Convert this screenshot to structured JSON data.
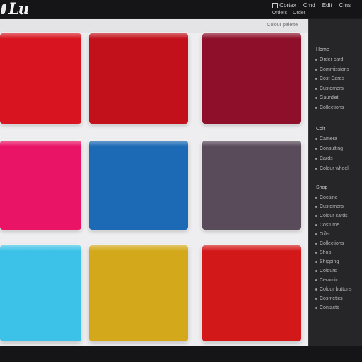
{
  "header": {
    "logo_text": "Lu",
    "top_nav": [
      "Cortex",
      "Cmd",
      "Edit",
      "Cms"
    ],
    "sub_nav": [
      "Orders",
      "Order"
    ]
  },
  "canvas": {
    "crumb": "Colour palette"
  },
  "swatches": [
    {
      "name": "red",
      "color": "#d7141f"
    },
    {
      "name": "crimson",
      "color": "#c3111c"
    },
    {
      "name": "burgundy",
      "color": "#8e0f2a"
    },
    {
      "name": "pink",
      "color": "#ea1466"
    },
    {
      "name": "blue",
      "color": "#1c6ab5"
    },
    {
      "name": "slate",
      "color": "#5a4b5b"
    },
    {
      "name": "cyan",
      "color": "#3cc2e8"
    },
    {
      "name": "mustard",
      "color": "#d3a81a"
    },
    {
      "name": "scarlet",
      "color": "#d3181a"
    }
  ],
  "sidebar": {
    "groups": [
      {
        "title": "Home",
        "items": [
          "Order card",
          "Commissions",
          "Cost Cards",
          "Customers",
          "Gauntlet",
          "Collections"
        ]
      },
      {
        "title": "Colt",
        "items": [
          "Camera",
          "Consulting",
          "Cards",
          "Colour wheel"
        ]
      },
      {
        "title": "Shop",
        "items": [
          "Cocaine",
          "Customers",
          "Colour cards",
          "Costume",
          "Gifts",
          "Collections",
          "Shop",
          "Shipping",
          "Colours",
          "Ceramic",
          "Colour buttons",
          "Cosmetics",
          "Contacts"
        ]
      }
    ]
  }
}
